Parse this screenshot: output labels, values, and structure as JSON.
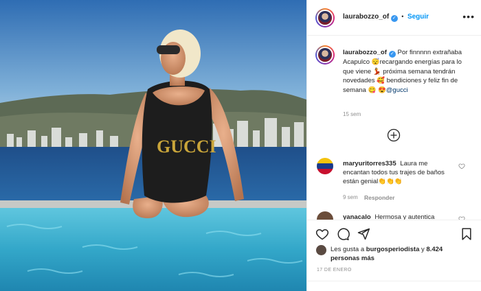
{
  "post": {
    "username": "laurabozzo_of",
    "follow_label": "Seguir",
    "separator": "•",
    "more_label": "•••",
    "caption": {
      "username": "laurabozzo_of",
      "text_1": "Por finnnnn extrañaba Acapulco",
      "emoji_1": "😴",
      "text_2": "recargando energías para lo que viene",
      "emoji_2": "💃",
      "text_3": "próxima semana tendrán novedades",
      "emoji_3": "🥰",
      "text_4": "bendiciones y feliz fin de semana",
      "emoji_4": "😋",
      "emoji_5": "😍",
      "tag": "@gucci"
    },
    "caption_time": "15 sem"
  },
  "comments": [
    {
      "username": "maryuritorres335",
      "text": "Laura me encantan todos tus trajes de baños están genial",
      "emojis": "👏👏👏",
      "time": "9 sem",
      "reply_label": "Responder"
    },
    {
      "username": "yanacalo",
      "text": "Hermosa y autentica"
    }
  ],
  "likes": {
    "prefix": "Les gusta a",
    "user": "burgosperiodista",
    "joiner": "y",
    "count": "8.424 personas más"
  },
  "date": "17 DE ENERO",
  "colors": {
    "accent": "#0095f6",
    "verified": "#3897f0",
    "muted": "#8e8e8e",
    "text": "#262626"
  }
}
